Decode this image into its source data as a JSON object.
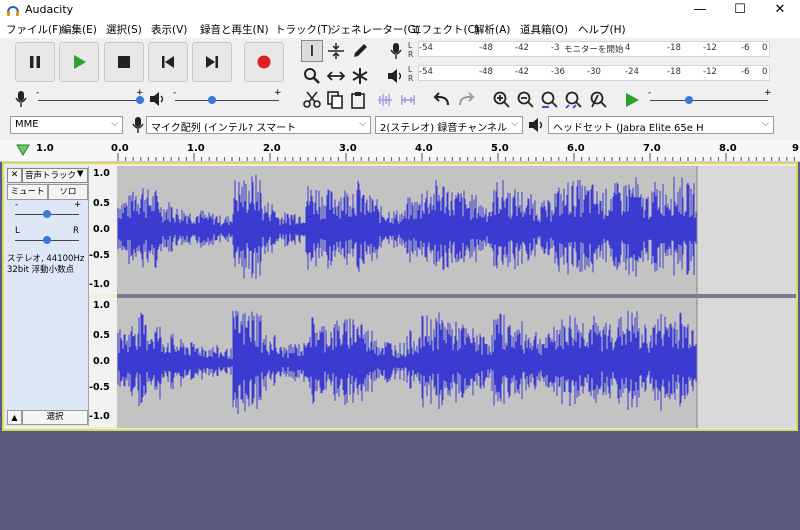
{
  "window": {
    "title": "Audacity",
    "controls": [
      "—",
      "☐",
      "✕"
    ]
  },
  "menu": [
    "ファイル(F)",
    "編集(E)",
    "選択(S)",
    "表示(V)",
    "録音と再生(N)",
    "トラック(T)",
    "ジェネレーター(G)",
    "エフェクト(C)",
    "解析(A)",
    "道具箱(O)",
    "ヘルプ(H)"
  ],
  "meters": {
    "record": {
      "lr": [
        "L",
        "R"
      ],
      "scale": [
        "-54",
        "-48",
        "-42",
        "-3",
        "モニターを開始",
        "4",
        "-18",
        "-12",
        "-6",
        "0"
      ]
    },
    "playback": {
      "lr": [
        "L",
        "R"
      ],
      "scale": [
        "-54",
        "-48",
        "-42",
        "-36",
        "-30",
        "-24",
        "-18",
        "-12",
        "-6",
        "0"
      ]
    }
  },
  "sliders": {
    "minus": "-",
    "plus": "+"
  },
  "devices": {
    "host": "MME",
    "recording_device": "マイク配列 (インテル? スマート",
    "channels": "2(ステレオ) 録音チャンネル",
    "playback_device": "ヘッドセット (Jabra Elite 65e H"
  },
  "ruler": {
    "left_label": "1.0",
    "ticks": [
      "0.0",
      "1.0",
      "2.0",
      "3.0",
      "4.0",
      "5.0",
      "6.0",
      "7.0",
      "8.0",
      "9"
    ]
  },
  "track": {
    "name": "音声トラック",
    "mute": "ミュート",
    "solo": "ソロ",
    "gain_minus": "-",
    "gain_plus": "+",
    "pan_left": "L",
    "pan_right": "R",
    "info_line1": "ステレオ, 44100Hz",
    "info_line2": "32bit 浮動小数点",
    "select": "選択",
    "close": "✕",
    "collapse": "▲",
    "menu_arrow": "▼"
  },
  "amplitude_labels": [
    "1.0",
    "0.5",
    "0.0",
    "-0.5",
    "-1.0"
  ],
  "colors": {
    "waveform": "#3b3bd2",
    "clip_bg": "#c3c3c3",
    "track_bg": "#d9d9d9",
    "record": "#e02020",
    "play": "#2ea02e"
  }
}
